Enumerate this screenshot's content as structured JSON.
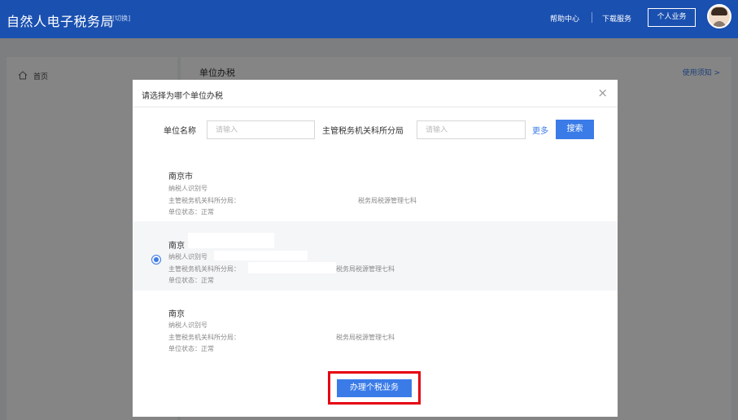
{
  "header": {
    "brand": "自然人电子税务局",
    "switch": "[切换]",
    "help": "帮助中心",
    "download": "下载服务",
    "personal": "个人业务"
  },
  "sidebar": {
    "home": "首页"
  },
  "main": {
    "title": "单位办税",
    "notice_link": "使用须知 >"
  },
  "modal": {
    "title": "请选择为哪个单位办税",
    "close": "×",
    "filters": {
      "unit_name_label": "单位名称",
      "unit_name_placeholder": "请输入",
      "bureau_label": "主管税务机关科所分局",
      "bureau_placeholder": "请输入",
      "more": "更多",
      "search": "搜索"
    },
    "units": [
      {
        "name": "南京市",
        "taxpayer_id_label": "纳税人识别号",
        "bureau_label": "主管税务机关科所分局：",
        "bureau_suffix": "税务局税源管理七科",
        "status": "单位状态：正常",
        "selected": false
      },
      {
        "name": "南京",
        "taxpayer_id_label": "纳税人识别号",
        "bureau_label": "主管税务机关科所分局：",
        "bureau_suffix": "税务局税源管理七科",
        "status": "单位状态：正常",
        "selected": true
      },
      {
        "name": "南京",
        "taxpayer_id_label": "纳税人识别号",
        "bureau_label": "主管税务机关科所分局：",
        "bureau_suffix": "税务局税源管理七科",
        "status": "单位状态：正常",
        "selected": false
      }
    ],
    "submit": "办理个税业务"
  },
  "colors": {
    "header": "#1a50b0",
    "accent": "#3a7be8",
    "highlight_border": "#e60012"
  },
  "icons": {
    "home": "home-icon",
    "close": "close-icon",
    "avatar": "avatar"
  }
}
